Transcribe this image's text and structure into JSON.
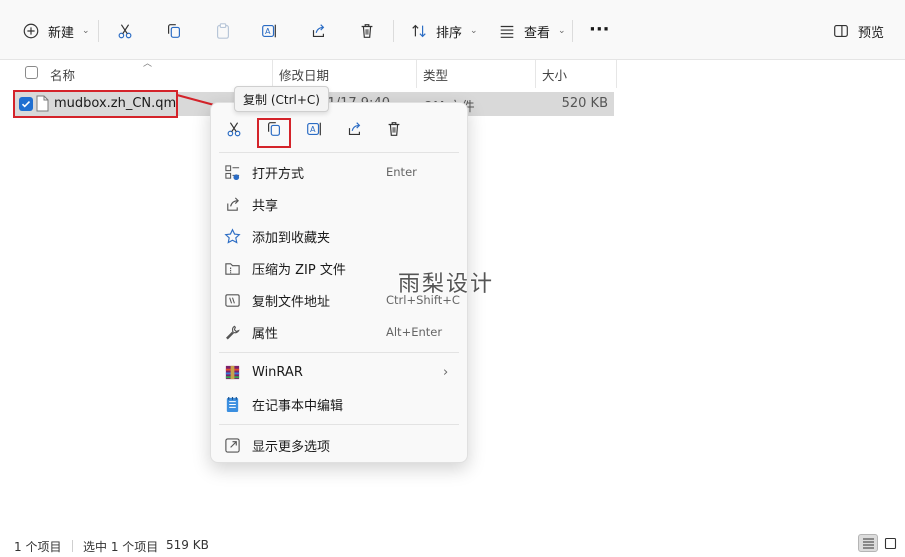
{
  "toolbar": {
    "new_label": "新建",
    "sort_label": "排序",
    "view_label": "查看",
    "more_label": "···",
    "preview_label": "预览"
  },
  "columns": {
    "name": "名称",
    "date": "修改日期",
    "type": "类型",
    "size": "大小"
  },
  "file": {
    "name": "mudbox.zh_CN.qm",
    "date": "2022/1/17 9:40",
    "type": "QM 文件",
    "size": "520 KB",
    "selected": true
  },
  "tooltip": "复制 (Ctrl+C)",
  "context_menu": {
    "icon_bar": [
      "cut-icon",
      "copy-icon",
      "rename-icon",
      "share-icon",
      "delete-icon"
    ],
    "items": [
      {
        "label": "打开方式",
        "shortcut": "Enter",
        "icon": "open-with-icon"
      },
      {
        "label": "共享",
        "shortcut": "",
        "icon": "share-icon"
      },
      {
        "label": "添加到收藏夹",
        "shortcut": "",
        "icon": "star-icon"
      },
      {
        "label": "压缩为 ZIP 文件",
        "shortcut": "",
        "icon": "zip-icon"
      },
      {
        "label": "复制文件地址",
        "shortcut": "Ctrl+Shift+C",
        "icon": "copy-path-icon"
      },
      {
        "label": "属性",
        "shortcut": "Alt+Enter",
        "icon": "wrench-icon"
      },
      {
        "label": "WinRAR",
        "shortcut": "",
        "icon": "winrar-icon",
        "submenu": true
      },
      {
        "label": "在记事本中编辑",
        "shortcut": "",
        "icon": "notepad-icon"
      },
      {
        "label": "显示更多选项",
        "shortcut": "",
        "icon": "more-options-icon"
      }
    ]
  },
  "watermark": "雨梨设计",
  "status": {
    "count": "1 个项目",
    "selected": "选中 1 个项目",
    "selected_size": "519 KB"
  },
  "colors": {
    "accent": "#1f6fd1",
    "highlight_red": "#d4232a",
    "selected_row": "#d9d9d9"
  }
}
